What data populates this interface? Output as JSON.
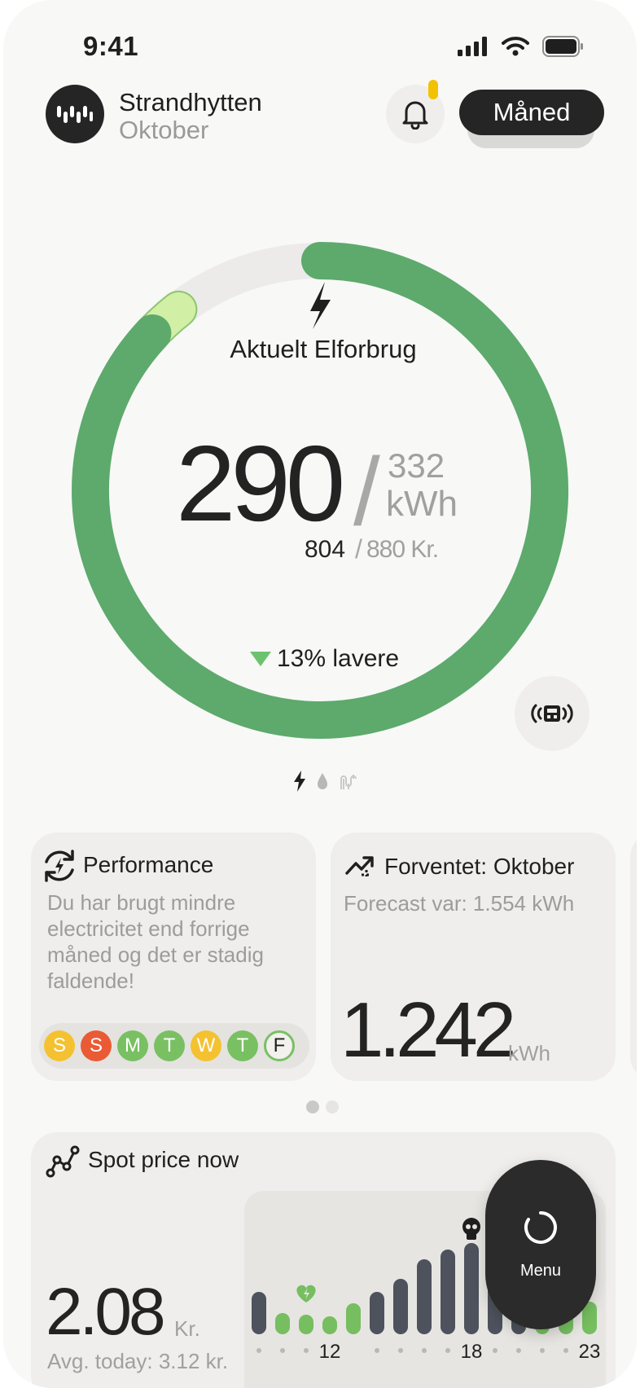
{
  "status_bar": {
    "time": "9:41"
  },
  "header": {
    "title": "Strandhytten",
    "subtitle": "Oktober",
    "period_button": "Måned"
  },
  "usage": {
    "label": "Aktuelt Elforbrug",
    "current": "290",
    "target": "332",
    "unit": "kWh",
    "cost_current": "804",
    "cost_total": "880 Kr.",
    "delta": "13% lavere",
    "progress_fraction": 0.87
  },
  "performance": {
    "title": "Performance",
    "text": "Du har brugt mindre electricitet end forrige måned og det er stadig faldende!",
    "days": [
      {
        "letter": "S",
        "color": "#f4c230"
      },
      {
        "letter": "S",
        "color": "#ea5a34"
      },
      {
        "letter": "M",
        "color": "#79c063"
      },
      {
        "letter": "T",
        "color": "#79c063"
      },
      {
        "letter": "W",
        "color": "#f4c230"
      },
      {
        "letter": "T",
        "color": "#79c063"
      },
      {
        "letter": "F",
        "color": "outline"
      }
    ]
  },
  "forecast": {
    "title": "Forventet: Oktober",
    "subtitle": "Forecast var: 1.554 kWh",
    "value": "1.242",
    "unit": "kWh"
  },
  "spot": {
    "title": "Spot price now",
    "price": "2.08",
    "unit": "Kr.",
    "avg": "Avg. today: 3.12 kr.",
    "hour_labels": [
      "12",
      "18",
      "23"
    ]
  },
  "menu": {
    "label": "Menu"
  },
  "colors": {
    "green": "#5daa6c",
    "light_green": "#d2efa6",
    "dark_bar": "#4d525c",
    "accent_yellow": "#f2c200"
  }
}
